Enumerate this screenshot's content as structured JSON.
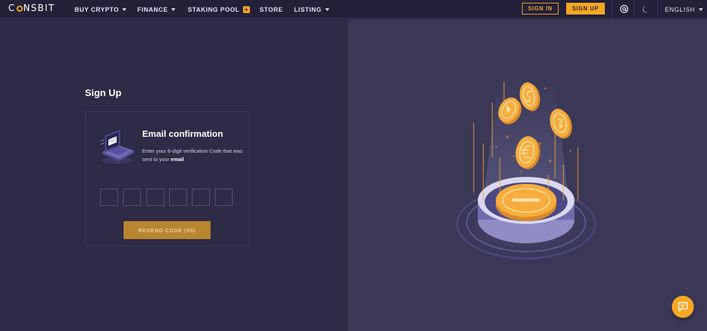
{
  "header": {
    "logo": "CONSBIT",
    "nav": [
      {
        "label": "BUY CRYPTO",
        "has_dropdown": true
      },
      {
        "label": "FINANCE",
        "has_dropdown": true
      },
      {
        "label": "STAKING POOL",
        "has_badge": true
      },
      {
        "label": "STORE",
        "has_dropdown": false
      },
      {
        "label": "LISTING",
        "has_dropdown": true
      }
    ],
    "sign_in": "SIGN IN",
    "sign_up": "SIGN UP",
    "language": "ENGLISH"
  },
  "signup": {
    "title": "Sign Up",
    "card_title": "Email confirmation",
    "desc_prefix": "Enter your 6-digit verification Code that was sent to your ",
    "desc_bold": "email",
    "code_boxes": 6,
    "resend_label": "RESEND CODE (55)"
  },
  "colors": {
    "accent": "#f5a623",
    "background": "#2d2b45",
    "header": "#23213a",
    "panel": "#3a3757",
    "button": "#b8862f"
  },
  "icons": {
    "chat": "chat-icon",
    "theme": "moon-icon",
    "account": "at-icon"
  }
}
